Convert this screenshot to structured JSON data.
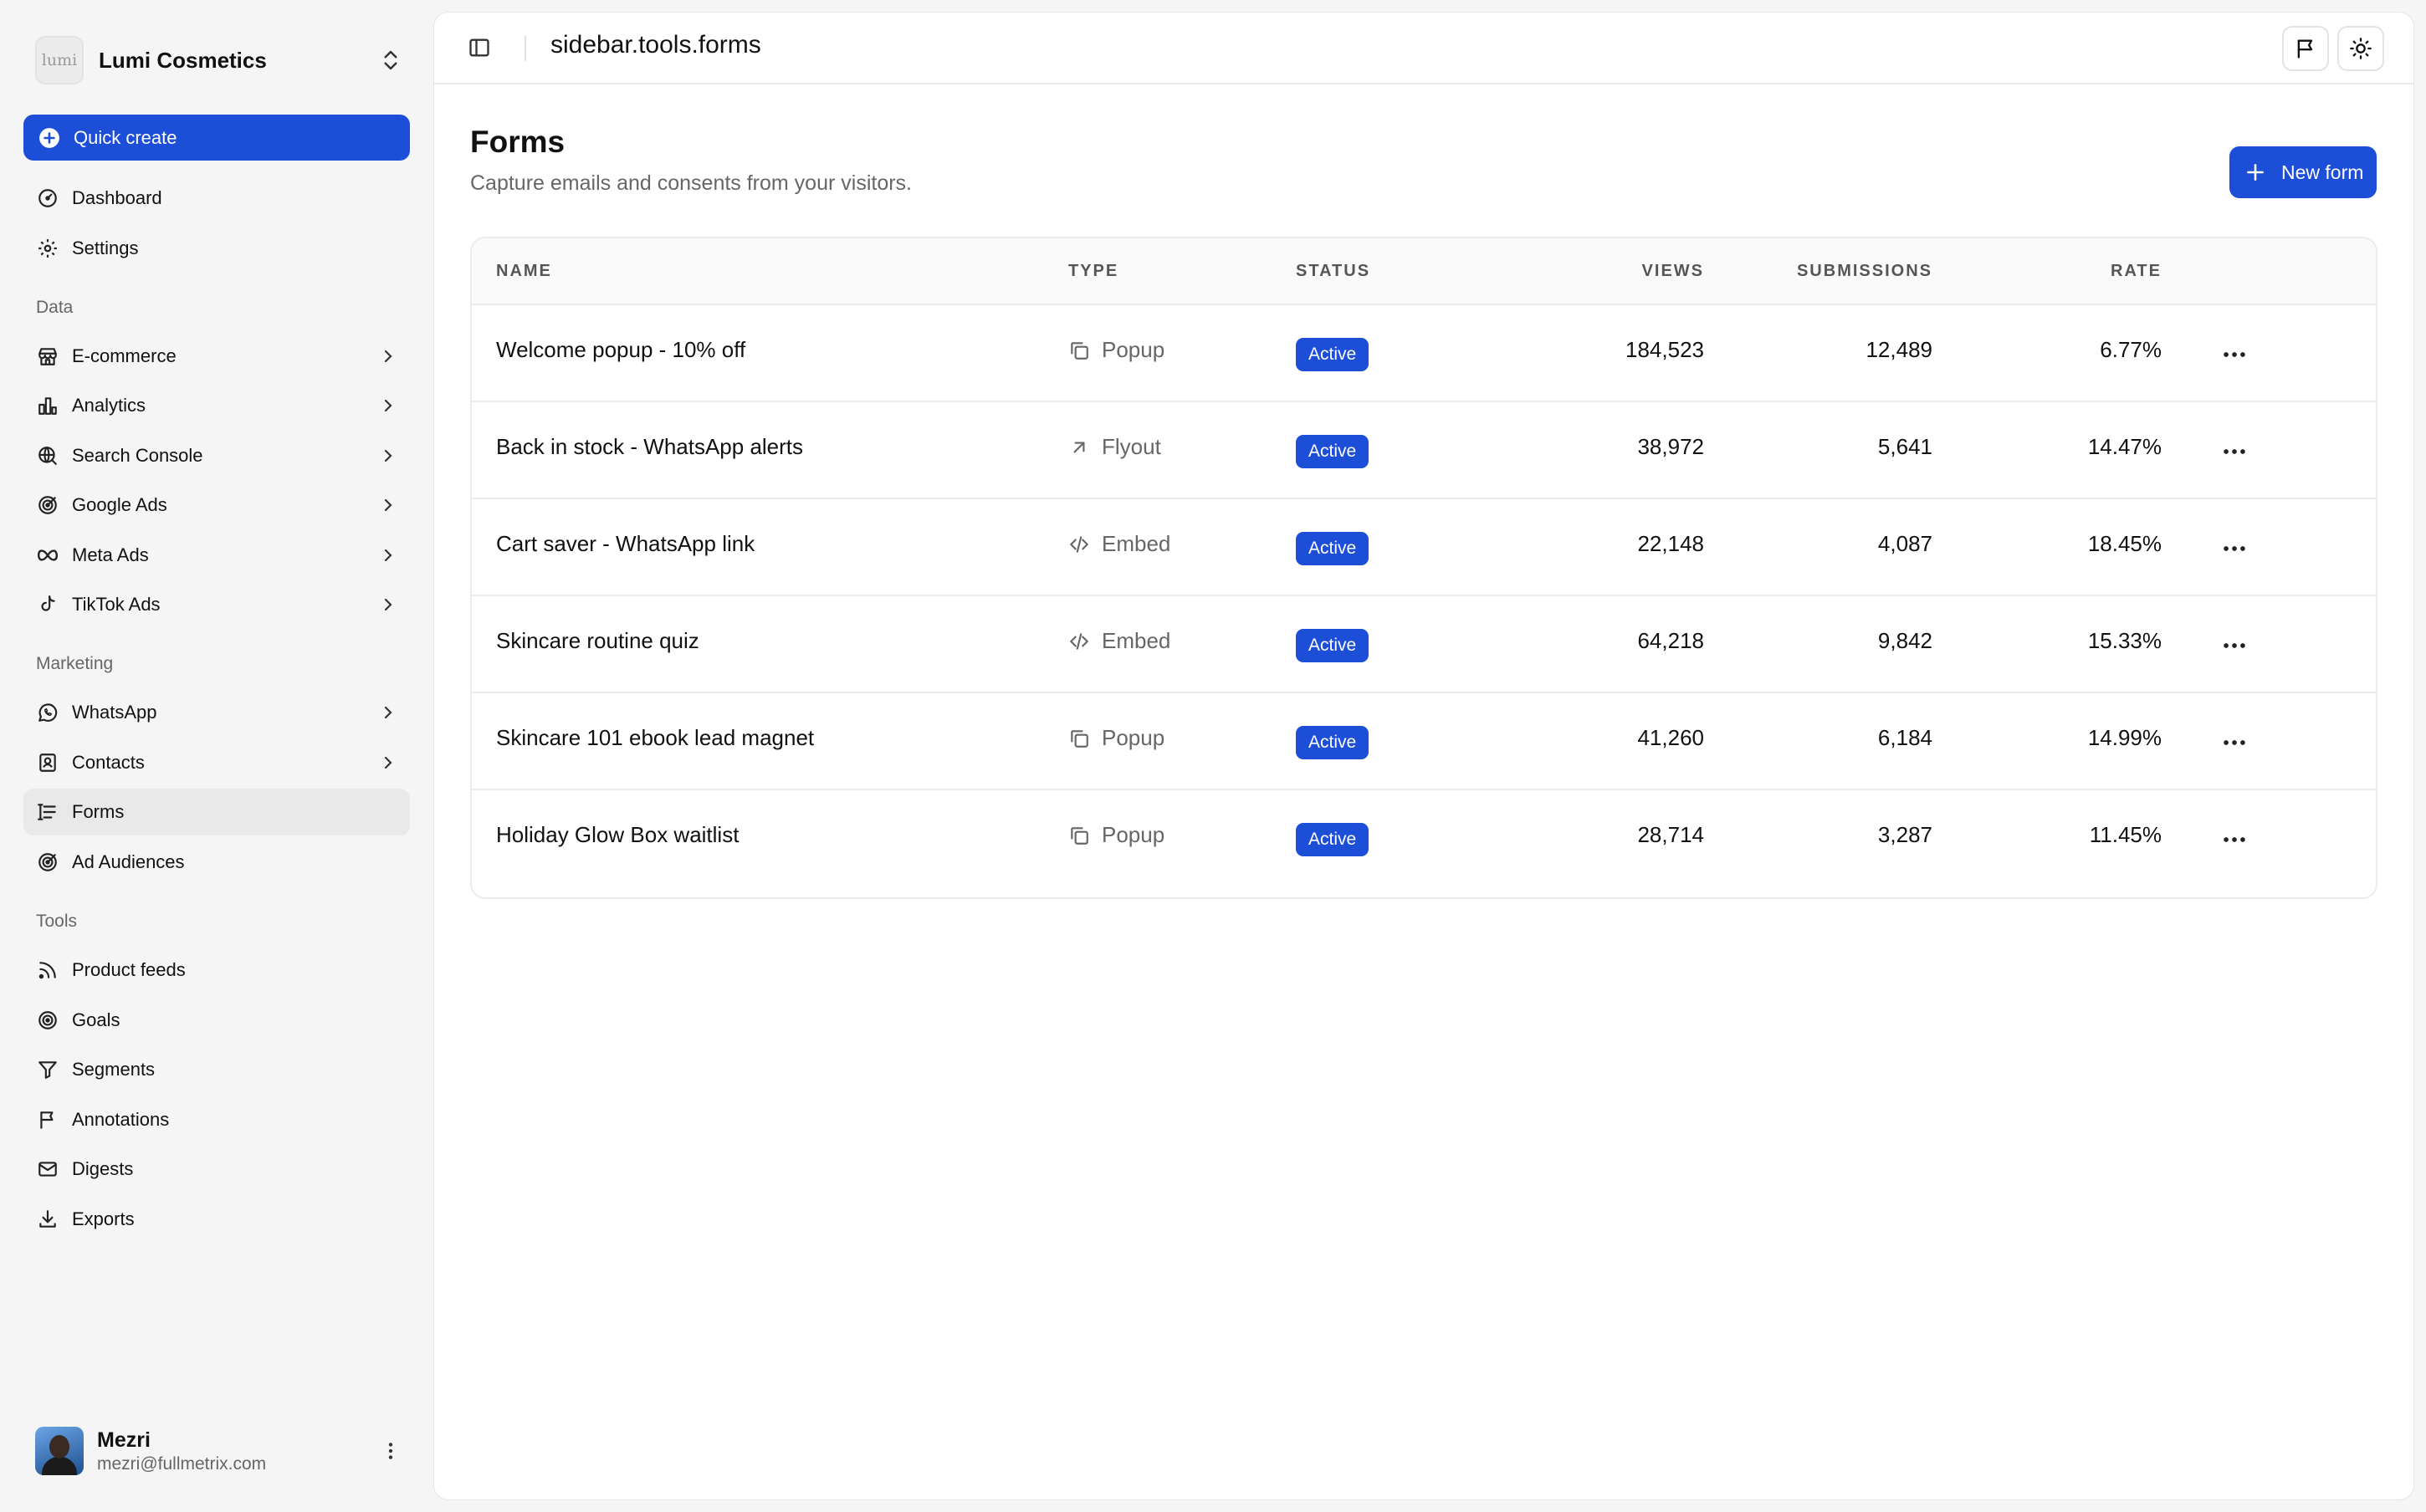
{
  "brand": {
    "logo_text": "lumi",
    "name": "Lumi Cosmetics"
  },
  "quick_create": "Quick create",
  "nav_top": [
    {
      "label": "Dashboard",
      "icon": "dashboard-icon"
    },
    {
      "label": "Settings",
      "icon": "gear-icon"
    }
  ],
  "sections": {
    "data": "Data",
    "marketing": "Marketing",
    "tools": "Tools"
  },
  "nav_data": [
    {
      "label": "E-commerce",
      "icon": "store-icon"
    },
    {
      "label": "Analytics",
      "icon": "bar-chart-icon"
    },
    {
      "label": "Search Console",
      "icon": "search-globe-icon"
    },
    {
      "label": "Google Ads",
      "icon": "target-icon"
    },
    {
      "label": "Meta Ads",
      "icon": "infinity-icon"
    },
    {
      "label": "TikTok Ads",
      "icon": "tiktok-icon"
    }
  ],
  "nav_marketing": [
    {
      "label": "WhatsApp",
      "icon": "whatsapp-icon"
    },
    {
      "label": "Contacts",
      "icon": "contacts-icon"
    },
    {
      "label": "Forms",
      "icon": "form-icon"
    },
    {
      "label": "Ad Audiences",
      "icon": "audience-icon"
    }
  ],
  "nav_tools": [
    {
      "label": "Product feeds",
      "icon": "rss-icon"
    },
    {
      "label": "Goals",
      "icon": "goal-icon"
    },
    {
      "label": "Segments",
      "icon": "filter-icon"
    },
    {
      "label": "Annotations",
      "icon": "flag-icon"
    },
    {
      "label": "Digests",
      "icon": "mail-icon"
    },
    {
      "label": "Exports",
      "icon": "download-icon"
    }
  ],
  "user": {
    "name": "Mezri",
    "email": "mezri@fullmetrix.com"
  },
  "topbar": {
    "breadcrumb": "sidebar.tools.forms"
  },
  "page": {
    "title": "Forms",
    "subtitle": "Capture emails and consents from your visitors.",
    "new_button": "New form"
  },
  "table": {
    "headers": {
      "name": "NAME",
      "type": "TYPE",
      "status": "STATUS",
      "views": "VIEWS",
      "submissions": "SUBMISSIONS",
      "rate": "RATE"
    },
    "rows": [
      {
        "name": "Welcome popup - 10% off",
        "type": "Popup",
        "status": "Active",
        "views": "184,523",
        "submissions": "12,489",
        "rate": "6.77%"
      },
      {
        "name": "Back in stock - WhatsApp alerts",
        "type": "Flyout",
        "status": "Active",
        "views": "38,972",
        "submissions": "5,641",
        "rate": "14.47%"
      },
      {
        "name": "Cart saver - WhatsApp link",
        "type": "Embed",
        "status": "Active",
        "views": "22,148",
        "submissions": "4,087",
        "rate": "18.45%"
      },
      {
        "name": "Skincare routine quiz",
        "type": "Embed",
        "status": "Active",
        "views": "64,218",
        "submissions": "9,842",
        "rate": "15.33%"
      },
      {
        "name": "Skincare 101 ebook lead magnet",
        "type": "Popup",
        "status": "Active",
        "views": "41,260",
        "submissions": "6,184",
        "rate": "14.99%"
      },
      {
        "name": "Holiday Glow Box waitlist",
        "type": "Popup",
        "status": "Active",
        "views": "28,714",
        "submissions": "3,287",
        "rate": "11.45%"
      }
    ]
  },
  "colors": {
    "accent": "#1d4ed8",
    "sidebar_bg": "#f5f5f5",
    "active_item_bg": "#e9e9e9"
  }
}
